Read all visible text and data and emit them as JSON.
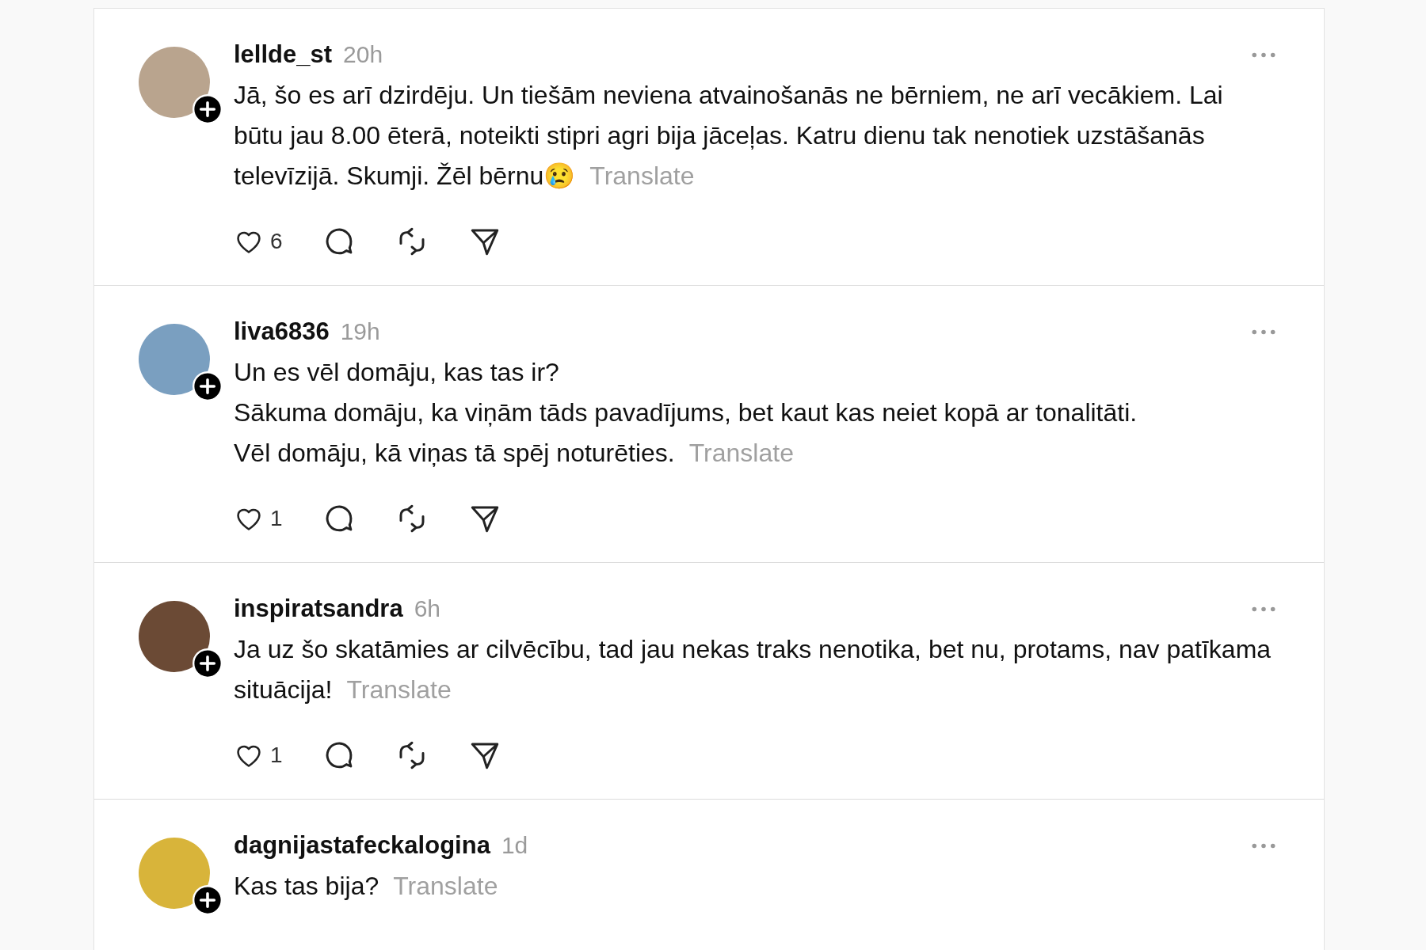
{
  "posts": [
    {
      "username": "lellde_st",
      "time": "20h",
      "text": "Jā, šo es arī dzirdēju. Un tiešām neviena atvainošanās ne bērniem, ne arī vecākiem. Lai būtu jau 8.00 ēterā, noteikti stipri agri bija jāceļas. Katru dienu tak nenotiek uzstāšanās televīzijā. Skumji. Žēl bērnu😢",
      "translate": "Translate",
      "actions": {
        "like_count": "6"
      }
    },
    {
      "username": "liva6836",
      "time": "19h",
      "text": "Un es vēl domāju, kas tas ir?\nSākuma domāju, ka viņām tāds pavadījums, bet kaut kas neiet kopā ar tonalitāti.\nVēl domāju, kā viņas tā spēj noturēties.",
      "translate": "Translate",
      "actions": {
        "like_count": "1"
      }
    },
    {
      "username": "inspiratsandra",
      "time": "6h",
      "text": "Ja uz šo skatāmies ar cilvēcību, tad jau nekas traks nenotika, bet nu, protams, nav patīkama situācija!",
      "translate": "Translate",
      "actions": {
        "like_count": "1"
      }
    },
    {
      "username": "dagnijastafeckalogina",
      "time": "1d",
      "text": "Kas tas bija?",
      "translate": "Translate"
    }
  ]
}
